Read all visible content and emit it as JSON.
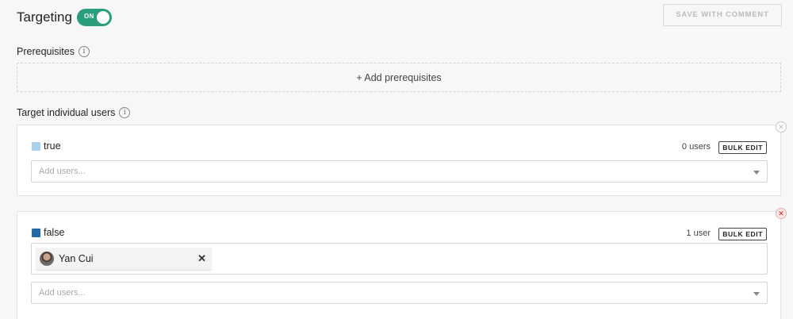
{
  "header": {
    "title": "Targeting",
    "toggle_label": "ON",
    "save_button": "SAVE WITH COMMENT"
  },
  "prerequisites": {
    "label": "Prerequisites",
    "add_label": "+ Add prerequisites"
  },
  "individual_targets": {
    "label": "Target individual users",
    "variations": [
      {
        "name": "true",
        "color": "#a9d1ec",
        "count": "0 users",
        "bulk_edit": "BULK EDIT",
        "placeholder": "Add users...",
        "users": []
      },
      {
        "name": "false",
        "color": "#2469a6",
        "count": "1 user",
        "bulk_edit": "BULK EDIT",
        "placeholder": "Add users...",
        "users": [
          "Yan Cui"
        ]
      }
    ]
  },
  "colors": {
    "toggle_on": "#2a9d7c",
    "remove_active": "#d0202a"
  }
}
